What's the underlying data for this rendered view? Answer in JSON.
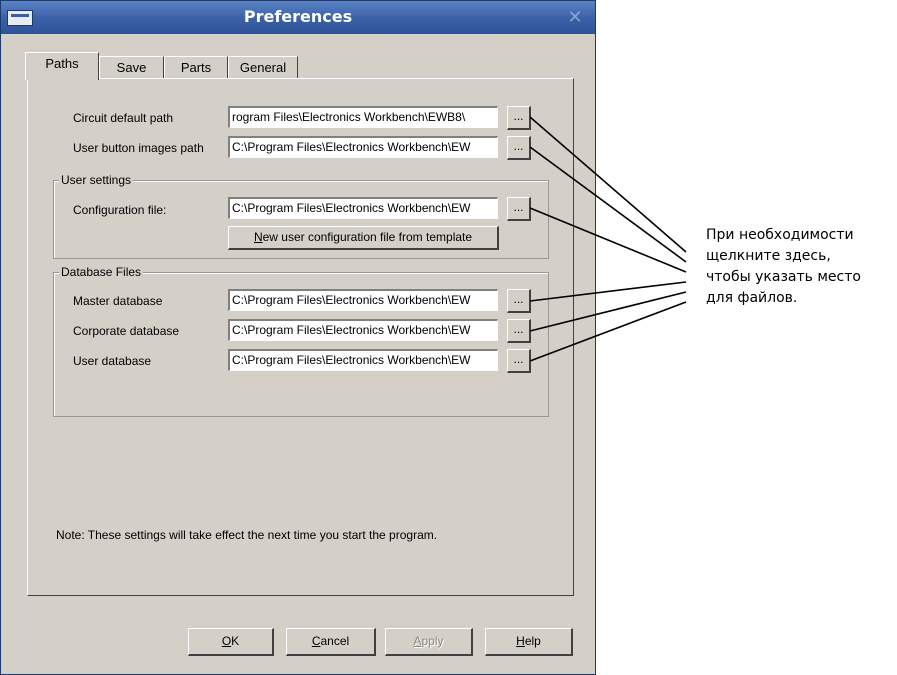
{
  "window": {
    "title": "Preferences",
    "close_glyph": "✕"
  },
  "tabs": [
    {
      "label": "Paths",
      "active": true
    },
    {
      "label": "Save",
      "active": false
    },
    {
      "label": "Parts",
      "active": false
    },
    {
      "label": "General",
      "active": false
    }
  ],
  "paths": {
    "circuit_label": "Circuit default path",
    "circuit_value": "rogram Files\\Electronics Workbench\\EWB8\\",
    "images_label": "User button images path",
    "images_value": "C:\\Program Files\\Electronics Workbench\\EW",
    "browse_label": "..."
  },
  "user_settings": {
    "title": "User settings",
    "config_label": "Configuration file:",
    "config_value": "C:\\Program Files\\Electronics Workbench\\EW",
    "new_config_prefix": "N",
    "new_config_rest": "ew user configuration file from template"
  },
  "database": {
    "title": "Database Files",
    "master_label": "Master database",
    "master_value": "C:\\Program Files\\Electronics Workbench\\EW",
    "corporate_label": "Corporate database",
    "corporate_value": "C:\\Program Files\\Electronics Workbench\\EW",
    "user_label": "User database",
    "user_value": "C:\\Program Files\\Electronics Workbench\\EW"
  },
  "note": "Note:  These settings will take effect the next time you start the program.",
  "buttons": {
    "ok_u": "O",
    "ok_rest": "K",
    "cancel_u": "C",
    "cancel_rest": "ancel",
    "apply_u": "A",
    "apply_rest": "pply",
    "help_u": "H",
    "help_rest": "elp"
  },
  "callout": {
    "line1": "При необходимости",
    "line2": "щелкните здесь,",
    "line3": "чтобы указать место",
    "line4": "для файлов."
  },
  "icons": [
    "window-menu-icon",
    "close-icon"
  ],
  "colors": {
    "titlebar": "#3c62a8",
    "dialog_bg": "#d4d0c8"
  }
}
